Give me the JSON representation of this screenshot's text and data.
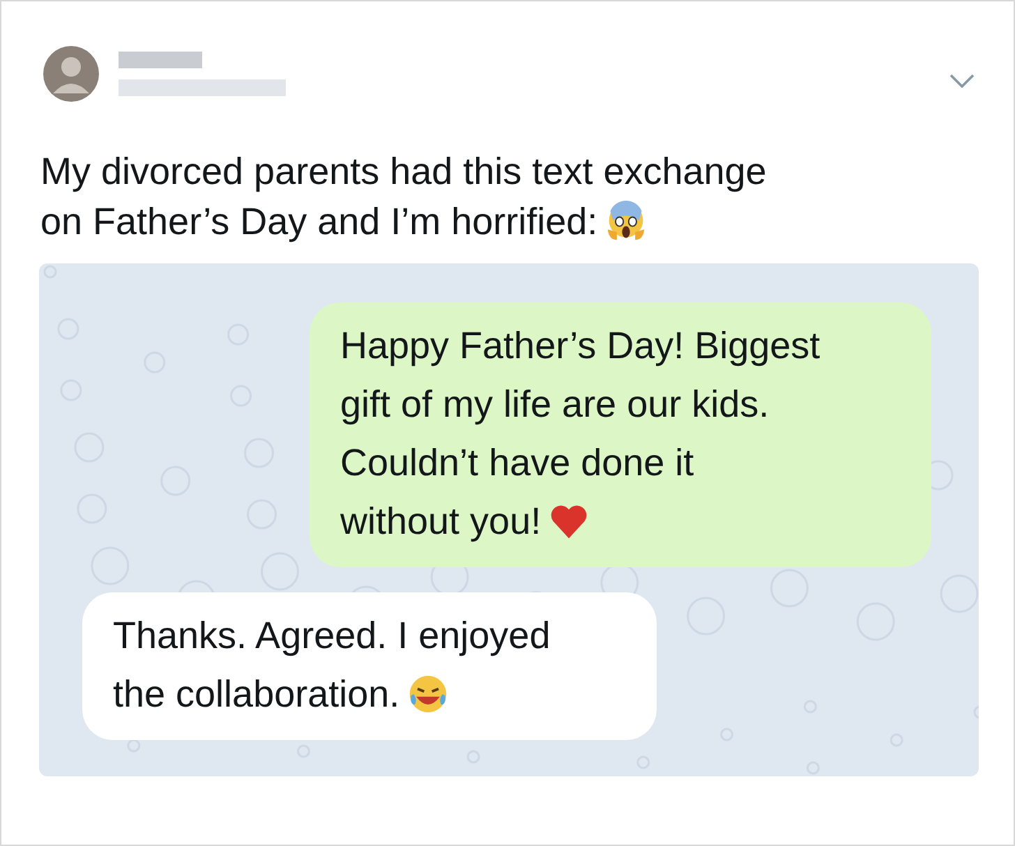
{
  "tweet": {
    "lines": [
      "My divorced parents had this text exchange",
      "on Father’s Day and I’m horrified:"
    ]
  },
  "chat": {
    "messages": [
      {
        "kind": "sent",
        "lines": [
          "Happy Father’s Day! Biggest",
          "gift of my life are our kids.",
          "Couldn’t have done it",
          "without you!"
        ]
      },
      {
        "kind": "received",
        "lines": [
          "Thanks. Agreed. I enjoyed",
          "the collaboration."
        ]
      }
    ]
  }
}
